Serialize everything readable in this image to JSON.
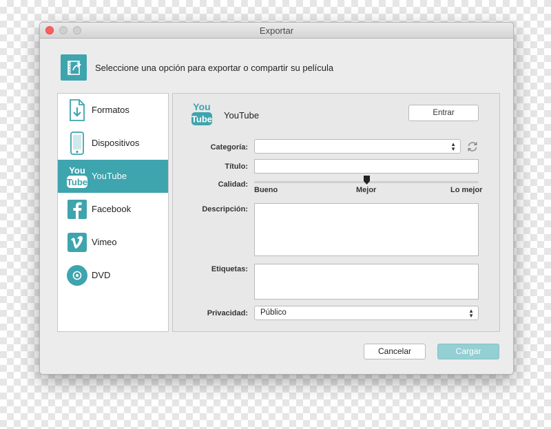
{
  "window": {
    "title": "Exportar"
  },
  "header": {
    "text": "Seleccione una opción para exportar o compartir su película"
  },
  "sidebar": {
    "items": [
      {
        "label": "Formatos",
        "icon": "file-download-icon"
      },
      {
        "label": "Dispositivos",
        "icon": "phone-icon"
      },
      {
        "label": "YouTube",
        "icon": "youtube-icon",
        "active": true
      },
      {
        "label": "Facebook",
        "icon": "facebook-icon"
      },
      {
        "label": "Vimeo",
        "icon": "vimeo-icon"
      },
      {
        "label": "DVD",
        "icon": "disc-icon"
      }
    ]
  },
  "panel": {
    "service": "YouTube",
    "logo": {
      "top": "You",
      "bottom": "Tube"
    },
    "login_label": "Entrar",
    "category_label": "Categoría:",
    "category_value": "",
    "title_label": "Título:",
    "title_value": "",
    "quality_label": "Calidad:",
    "quality_options": {
      "low": "Bueno",
      "mid": "Mejor",
      "high": "Lo mejor"
    },
    "quality_level": 0.5,
    "description_label": "Descripción:",
    "tags_label": "Etiquetas:",
    "privacy_label": "Privacidad:",
    "privacy_value": "Público"
  },
  "footer": {
    "cancel_label": "Cancelar",
    "upload_label": "Cargar"
  },
  "colors": {
    "accent": "#3ea4ae",
    "accent_disabled": "#93cfd3",
    "close": "#fc605c"
  }
}
